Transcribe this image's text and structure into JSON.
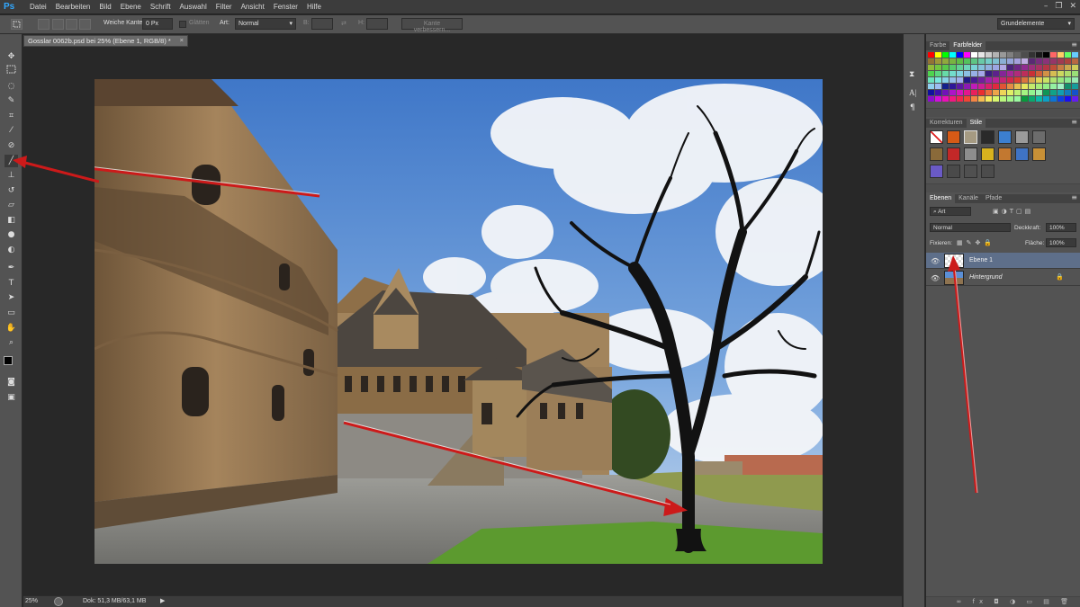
{
  "app": {
    "logo": "Ps"
  },
  "menu": [
    "Datei",
    "Bearbeiten",
    "Bild",
    "Ebene",
    "Schrift",
    "Auswahl",
    "Filter",
    "Ansicht",
    "Fenster",
    "Hilfe"
  ],
  "window_controls": {
    "minimize": "–",
    "restore": "❐",
    "close": "✕"
  },
  "options": {
    "feather_label": "Weiche Kante:",
    "feather_value": "0 Px",
    "antialias_label": "Glätten",
    "style_label": "Art:",
    "style_value": "Normal",
    "width_label": "B:",
    "height_label": "H:",
    "refine_edge_label": "Kante verbessern...",
    "workspace_value": "Grundelemente"
  },
  "document": {
    "tab_title": "Gosslar 0062b.psd bei 25% (Ebene 1, RGB/8) *",
    "tab_close": "×"
  },
  "status": {
    "zoom": "25%",
    "doc_info": "Dok: 51,3 MB/63,1 MB",
    "arrow": "▶"
  },
  "panels": {
    "color_tabs": [
      "Farbe",
      "Farbfelder"
    ],
    "adjust_tabs": [
      "Korrekturen",
      "Stile"
    ],
    "layers_tabs": [
      "Ebenen",
      "Kanäle",
      "Pfade"
    ],
    "menu_icon": "≡",
    "layers": {
      "filter_kind": "Art",
      "blend_mode": "Normal",
      "opacity_label": "Deckkraft:",
      "opacity_value": "100%",
      "lock_label": "Fixieren:",
      "fill_label": "Fläche:",
      "fill_value": "100%",
      "items": [
        {
          "name": "Ebene 1",
          "selected": true
        },
        {
          "name": "Hintergrund",
          "selected": false
        }
      ]
    }
  },
  "tool_icons": [
    "move-icon",
    "marquee-icon",
    "lasso-icon",
    "quick-select-icon",
    "crop-icon",
    "eyedropper-icon",
    "healing-brush-icon",
    "brush-icon",
    "clone-stamp-icon",
    "history-brush-icon",
    "eraser-icon",
    "gradient-icon",
    "blur-icon",
    "dodge-icon",
    "pen-icon",
    "type-icon",
    "path-select-icon",
    "shape-icon",
    "hand-icon",
    "zoom-icon"
  ],
  "swatch_colors": [
    "#ff0000",
    "#ffff00",
    "#00ff00",
    "#00ffff",
    "#0000ff",
    "#ff00ff",
    "#ffffff",
    "#e6e6e6",
    "#cccccc",
    "#b3b3b3",
    "#999999",
    "#808080",
    "#666666",
    "#4d4d4d",
    "#333333",
    "#1a1a1a",
    "#000000",
    "#ff6666",
    "#ffcc66",
    "#66ff66",
    "#66ccff"
  ],
  "colors": {
    "accent_arrow": "#cc1a1a",
    "selected_layer": "#5e6f8a"
  }
}
